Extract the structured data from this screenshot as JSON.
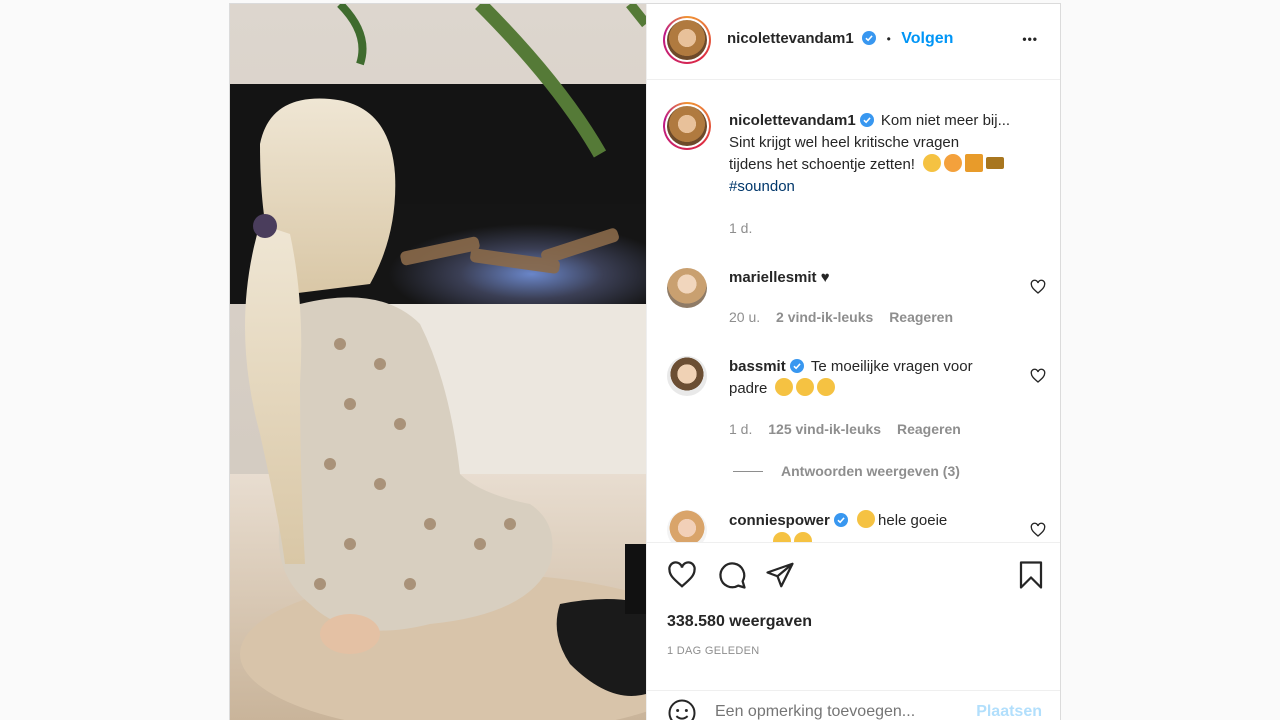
{
  "post": {
    "username": "nicolettevandam1",
    "follow_label": "Volgen",
    "separator": "•",
    "more_label": "•••"
  },
  "caption": {
    "username": "nicolettevandam1",
    "text_line1": "Kom niet meer bij...",
    "text_line2": "Sint krijgt wel heel kritische vragen",
    "text_line3": "tijdens het schoentje zetten!",
    "hashtag": "#soundon",
    "time": "1 d."
  },
  "comments": [
    {
      "username": "mariellesmit",
      "text": "♥",
      "time": "20 u.",
      "likes": "2 vind-ik-leuks",
      "reply": "Reageren"
    },
    {
      "username": "bassmit",
      "text_line1": "Te moeilijke vragen voor",
      "text_line2": "padre",
      "time": "1 d.",
      "likes": "125 vind-ik-leuks",
      "reply": "Reageren",
      "view_replies": "Antwoorden weergeven (3)"
    },
    {
      "username": "conniespower",
      "text": "hele goeie"
    }
  ],
  "stats": {
    "views": "338.580 weergaven",
    "date": "1 DAG GELEDEN"
  },
  "add_comment": {
    "placeholder": "Een opmerking toevoegen...",
    "post_label": "Plaatsen"
  },
  "colors": {
    "link": "#0095f6",
    "hashtag": "#00376b",
    "verified": "#3897f0",
    "muted": "#8e8e8e",
    "post_disabled": "#b2dffc"
  },
  "icons": [
    "verified-badge-icon",
    "more-icon",
    "heart-icon",
    "comment-icon",
    "share-icon",
    "bookmark-icon",
    "emoji-icon"
  ]
}
